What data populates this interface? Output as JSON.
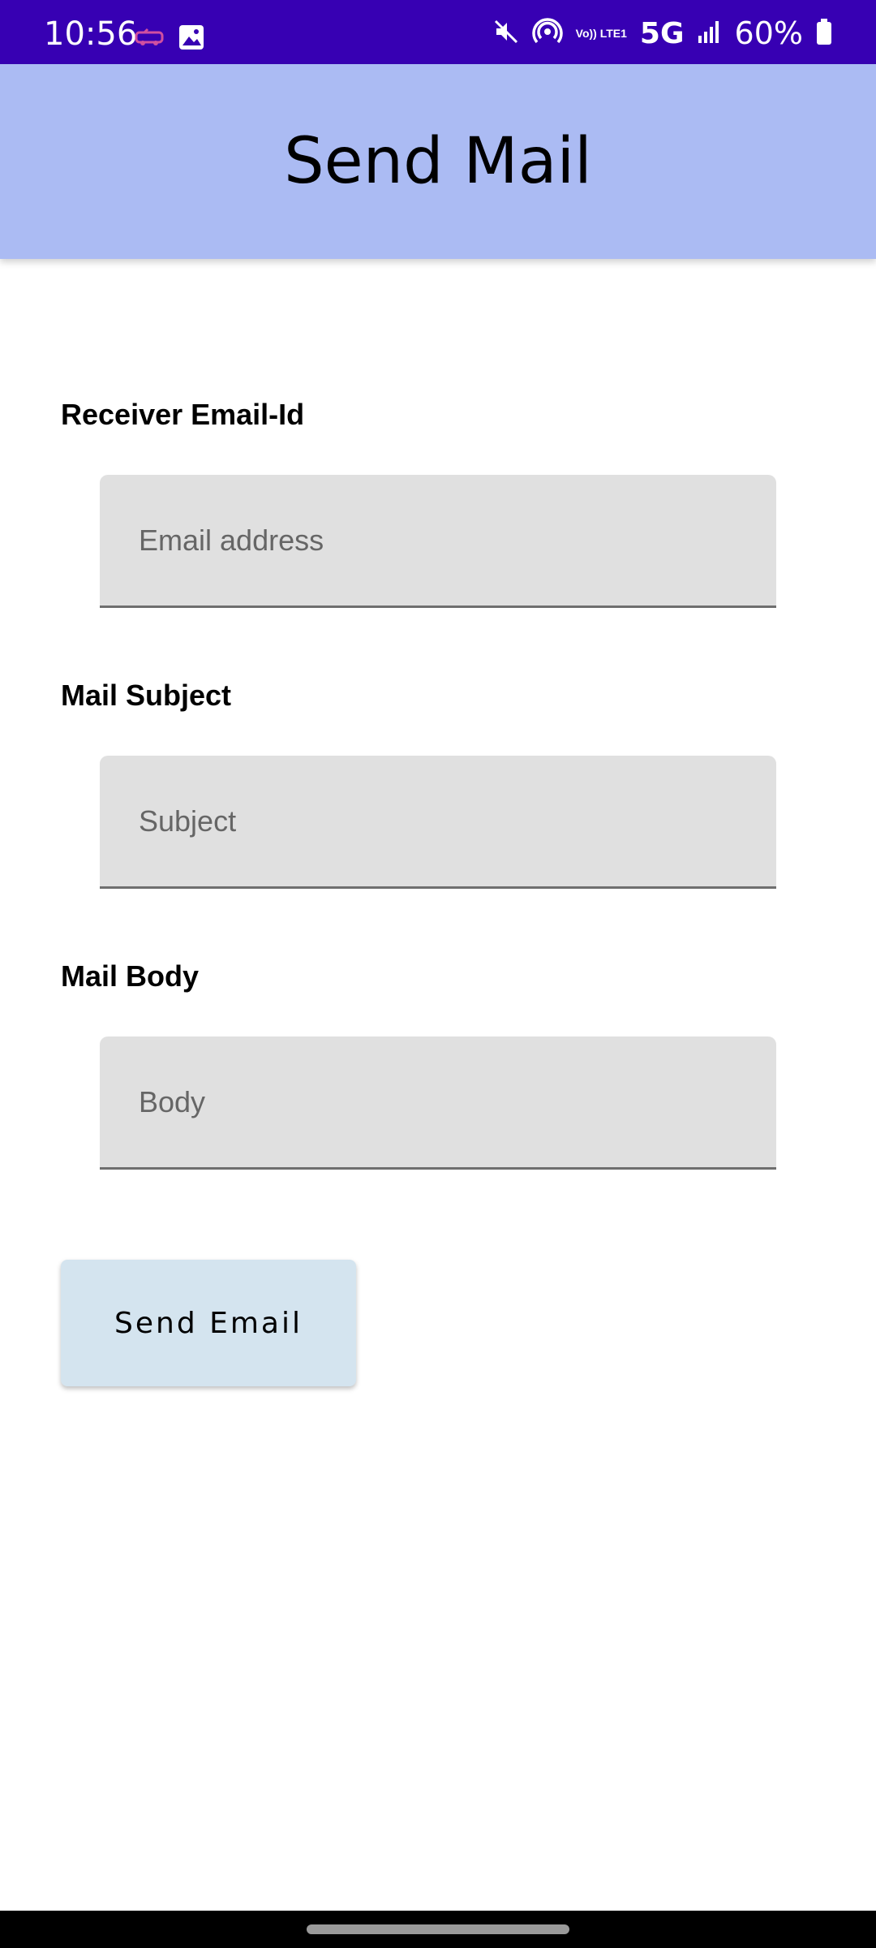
{
  "status_bar": {
    "time": "10:56",
    "network": "5G",
    "volte": "Vo)) LTE1",
    "battery": "60%",
    "icons": [
      "car-icon",
      "image-icon",
      "mute-icon",
      "hotspot-icon",
      "volte-icon",
      "signal-icon",
      "battery-icon"
    ]
  },
  "app_bar": {
    "title": "Send Mail"
  },
  "form": {
    "email": {
      "label": "Receiver Email-Id",
      "placeholder": "Email address",
      "value": ""
    },
    "subject": {
      "label": "Mail Subject",
      "placeholder": "Subject",
      "value": ""
    },
    "body": {
      "label": "Mail Body",
      "placeholder": "Body",
      "value": ""
    },
    "send_label": "Send Email"
  },
  "colors": {
    "status_bar": "#3700B3",
    "app_bar": "#ABBBF3",
    "field_bg": "#E0E0E0",
    "button_bg": "#D4E4EF"
  }
}
